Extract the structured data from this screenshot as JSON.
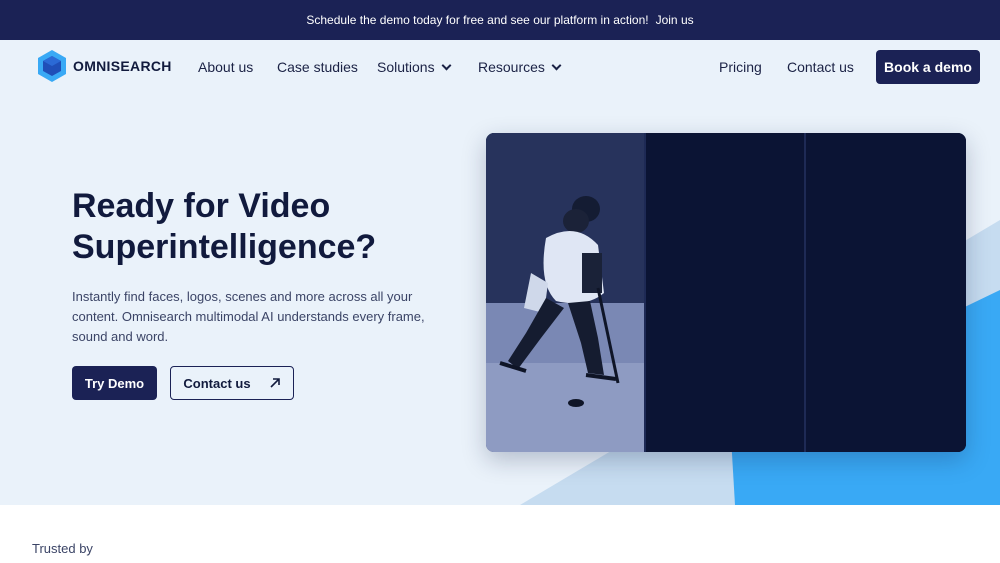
{
  "announcement": {
    "text": "Schedule the demo today for free and see our platform in action!",
    "link": "Join us"
  },
  "brand": {
    "name": "OMNISEARCH"
  },
  "nav": {
    "about": "About us",
    "case_studies": "Case studies",
    "solutions": "Solutions",
    "resources": "Resources",
    "pricing": "Pricing",
    "contact": "Contact us",
    "book_demo": "Book a demo"
  },
  "hero": {
    "title": "Ready for Video Superintelligence?",
    "description": "Instantly find faces, logos, scenes and more across all your content. Omnisearch multimodal AI understands every frame, sound and word.",
    "try_demo": "Try Demo",
    "contact": "Contact us"
  },
  "trusted": {
    "label": "Trusted by"
  },
  "colors": {
    "navy": "#1b2255",
    "hero_bg": "#eaf2fa",
    "accent_blue": "#39a9f5"
  },
  "icons": {
    "logo": "hexagon-cube-icon",
    "chevron": "chevron-down-icon",
    "arrow": "arrow-up-right-icon"
  }
}
